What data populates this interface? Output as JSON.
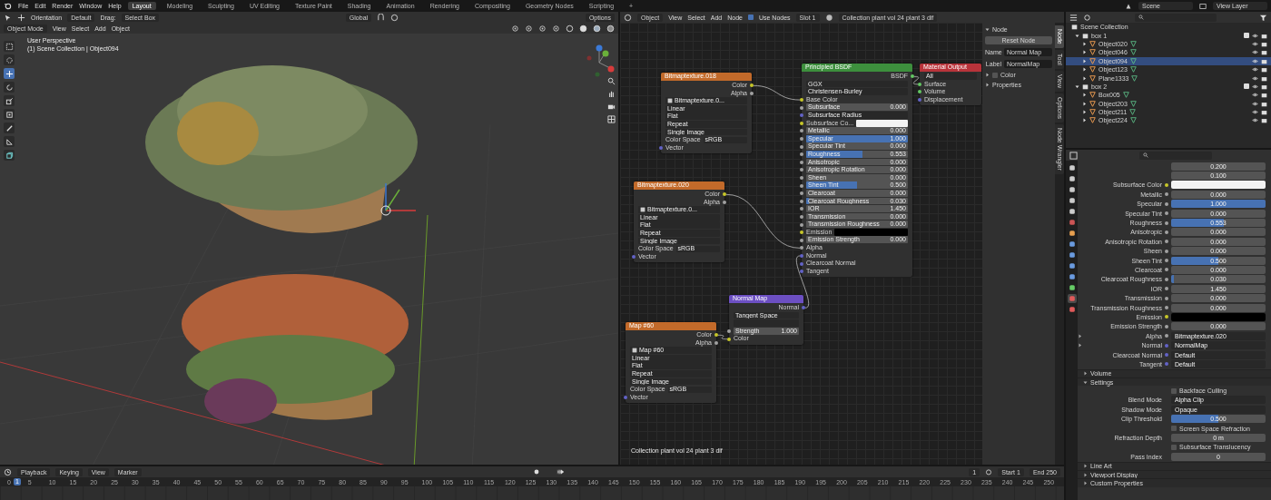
{
  "topbar": {
    "menus": [
      "File",
      "Edit",
      "Render",
      "Window",
      "Help"
    ],
    "workspaces": [
      {
        "label": "Layout",
        "selected": true
      },
      {
        "label": "Modeling",
        "selected": false
      },
      {
        "label": "Sculpting",
        "selected": false
      },
      {
        "label": "UV Editing",
        "selected": false
      },
      {
        "label": "Texture Paint",
        "selected": false
      },
      {
        "label": "Shading",
        "selected": false
      },
      {
        "label": "Animation",
        "selected": false
      },
      {
        "label": "Rendering",
        "selected": false
      },
      {
        "label": "Compositing",
        "selected": false
      },
      {
        "label": "Geometry Nodes",
        "selected": false
      },
      {
        "label": "Scripting",
        "selected": false
      }
    ],
    "add_tab": "+",
    "scene": "Scene",
    "view_layer": "View Layer"
  },
  "viewport": {
    "tool_header": {
      "orientation": "Orientation",
      "transform": "Default",
      "drag_label": "Drag:",
      "drag": "Select Box",
      "pivot": "Global",
      "options": "Options"
    },
    "header": {
      "mode": "Object Mode",
      "menus": [
        "View",
        "Select",
        "Add",
        "Object"
      ]
    },
    "overlay": {
      "title": "User Perspective",
      "subtitle": "(1) Scene Collection | Object094"
    },
    "tools": [
      {
        "kind": "select",
        "selected": false
      },
      {
        "kind": "cursor",
        "selected": false
      },
      {
        "kind": "move",
        "selected": true
      },
      {
        "kind": "rotate",
        "selected": false
      },
      {
        "kind": "scale",
        "selected": false
      },
      {
        "kind": "transform",
        "selected": false
      },
      {
        "kind": "annotate",
        "selected": false
      },
      {
        "kind": "measure",
        "selected": false
      },
      {
        "kind": "add",
        "selected": false
      }
    ]
  },
  "node_editor": {
    "header": {
      "type": "Object",
      "menus": [
        "View",
        "Select",
        "Add",
        "Node"
      ],
      "use_nodes": {
        "label": "Use Nodes",
        "checked": true
      },
      "slot": "Slot 1",
      "material": "Collection plant vol 24 plant 3 dif"
    },
    "nodes": [
      {
        "kind": "image_texture",
        "title": "Bitmaptexture.018",
        "color": "#c26a2a",
        "rows": [
          {
            "kind": "output",
            "label": "Color",
            "socket": {
              "color": "#c7c729"
            }
          },
          {
            "kind": "output",
            "label": "Alpha",
            "socket": {
              "color": "#a1a1a1"
            }
          },
          {
            "kind": "image",
            "value": "Bitmaptexture.0..."
          },
          {
            "kind": "dropdown",
            "value": "Linear"
          },
          {
            "kind": "dropdown",
            "value": "Flat"
          },
          {
            "kind": "dropdown",
            "value": "Repeat"
          },
          {
            "kind": "dropdown",
            "value": "Single Image"
          },
          {
            "kind": "prop",
            "label": "Color Space",
            "value": "sRGB"
          },
          {
            "kind": "input",
            "label": "Vector",
            "socket": {
              "color": "#6363c7"
            }
          }
        ]
      },
      {
        "kind": "image_texture",
        "title": "Bitmaptexture.020",
        "color": "#c26a2a",
        "rows": [
          {
            "kind": "output",
            "label": "Color",
            "socket": {
              "color": "#c7c729"
            }
          },
          {
            "kind": "output",
            "label": "Alpha",
            "socket": {
              "color": "#a1a1a1"
            }
          },
          {
            "kind": "image",
            "value": "Bitmaptexture.0..."
          },
          {
            "kind": "dropdown",
            "value": "Linear"
          },
          {
            "kind": "dropdown",
            "value": "Flat"
          },
          {
            "kind": "dropdown",
            "value": "Repeat"
          },
          {
            "kind": "dropdown",
            "value": "Single Image"
          },
          {
            "kind": "prop",
            "label": "Color Space",
            "value": "sRGB"
          },
          {
            "kind": "input",
            "label": "Vector",
            "socket": {
              "color": "#6363c7"
            }
          }
        ]
      },
      {
        "kind": "normal_map",
        "title": "Normal Map",
        "color": "#6c4fc2",
        "rows": [
          {
            "kind": "output",
            "label": "Normal",
            "socket": {
              "color": "#6363c7"
            }
          },
          {
            "kind": "dropdown",
            "value": "Tangent Space"
          },
          {
            "kind": "uv"
          },
          {
            "kind": "field",
            "label": "Strength",
            "value": "1.000",
            "socket": {
              "color": "#a1a1a1"
            }
          },
          {
            "kind": "input",
            "label": "Color",
            "socket": {
              "color": "#c7c729"
            }
          }
        ]
      },
      {
        "kind": "image_texture",
        "title": "Map #60",
        "color": "#c26a2a",
        "rows": [
          {
            "kind": "output",
            "label": "Color",
            "socket": {
              "color": "#c7c729"
            }
          },
          {
            "kind": "output",
            "label": "Alpha",
            "socket": {
              "color": "#a1a1a1"
            }
          },
          {
            "kind": "image",
            "value": "Map #60"
          },
          {
            "kind": "dropdown",
            "value": "Linear"
          },
          {
            "kind": "dropdown",
            "value": "Flat"
          },
          {
            "kind": "dropdown",
            "value": "Repeat"
          },
          {
            "kind": "dropdown",
            "value": "Single Image"
          },
          {
            "kind": "prop",
            "label": "Color Space",
            "value": "sRGB"
          },
          {
            "kind": "input",
            "label": "Vector",
            "socket": {
              "color": "#6363c7"
            }
          }
        ]
      },
      {
        "kind": "principled",
        "title": "Principled BSDF",
        "color": "#3d8f3d",
        "rows": [
          {
            "kind": "output",
            "label": "BSDF",
            "socket": {
              "color": "#63c763"
            }
          },
          {
            "kind": "dropdown",
            "value": "GGX"
          },
          {
            "kind": "dropdown",
            "value": "Christensen-Burley"
          },
          {
            "kind": "input",
            "label": "Base Color",
            "socket": {
              "color": "#c7c729"
            }
          },
          {
            "kind": "slider",
            "label": "Subsurface",
            "value": "0.000",
            "level": 0,
            "socket": {
              "color": "#a1a1a1"
            }
          },
          {
            "kind": "dropdown",
            "value": "Subsurface Radius",
            "socket": {
              "color": "#6363c7"
            }
          },
          {
            "kind": "swatch",
            "label": "Subsurface Co...",
            "color": "#f2f2f2",
            "socket": {
              "color": "#c7c729"
            }
          },
          {
            "kind": "slider",
            "label": "Metallic",
            "value": "0.000",
            "level": 0,
            "socket": {
              "color": "#a1a1a1"
            }
          },
          {
            "kind": "slider",
            "label": "Specular",
            "value": "1.000",
            "level": 1,
            "socket": {
              "color": "#a1a1a1"
            }
          },
          {
            "kind": "slider",
            "label": "Specular Tint",
            "value": "0.000",
            "level": 0,
            "socket": {
              "color": "#a1a1a1"
            }
          },
          {
            "kind": "slider",
            "label": "Roughness",
            "value": "0.553",
            "level": 0.553,
            "socket": {
              "color": "#a1a1a1"
            }
          },
          {
            "kind": "slider",
            "label": "Anisotropic",
            "value": "0.000",
            "level": 0,
            "socket": {
              "color": "#a1a1a1"
            }
          },
          {
            "kind": "slider",
            "label": "Anisotropic Rotation",
            "value": "0.000",
            "level": 0,
            "socket": {
              "color": "#a1a1a1"
            }
          },
          {
            "kind": "slider",
            "label": "Sheen",
            "value": "0.000",
            "level": 0,
            "socket": {
              "color": "#a1a1a1"
            }
          },
          {
            "kind": "slider",
            "label": "Sheen Tint",
            "value": "0.500",
            "level": 0.5,
            "socket": {
              "color": "#a1a1a1"
            }
          },
          {
            "kind": "slider",
            "label": "Clearcoat",
            "value": "0.000",
            "level": 0,
            "socket": {
              "color": "#a1a1a1"
            }
          },
          {
            "kind": "slider",
            "label": "Clearcoat Roughness",
            "value": "0.030",
            "level": 0.03,
            "socket": {
              "color": "#a1a1a1"
            }
          },
          {
            "kind": "slider",
            "label": "IOR",
            "value": "1.450",
            "level": 0,
            "socket": {
              "color": "#a1a1a1"
            }
          },
          {
            "kind": "slider",
            "label": "Transmission",
            "value": "0.000",
            "level": 0,
            "socket": {
              "color": "#a1a1a1"
            }
          },
          {
            "kind": "slider",
            "label": "Transmission Roughness",
            "value": "0.000",
            "level": 0,
            "socket": {
              "color": "#a1a1a1"
            }
          },
          {
            "kind": "swatch",
            "label": "Emission",
            "color": "#000000",
            "socket": {
              "color": "#c7c729"
            }
          },
          {
            "kind": "slider",
            "label": "Emission Strength",
            "value": "0.000",
            "level": 0,
            "socket": {
              "color": "#a1a1a1"
            }
          },
          {
            "kind": "input",
            "label": "Alpha",
            "socket": {
              "color": "#a1a1a1"
            }
          },
          {
            "kind": "input",
            "label": "Normal",
            "socket": {
              "color": "#6363c7"
            }
          },
          {
            "kind": "input",
            "label": "Clearcoat Normal",
            "socket": {
              "color": "#6363c7"
            }
          },
          {
            "kind": "input",
            "label": "Tangent",
            "socket": {
              "color": "#6363c7"
            }
          }
        ]
      },
      {
        "kind": "output",
        "title": "Material Output",
        "color": "#b8333a",
        "rows": [
          {
            "kind": "dropdown",
            "value": "All"
          },
          {
            "kind": "input",
            "label": "Surface",
            "socket": {
              "color": "#63c763"
            }
          },
          {
            "kind": "input",
            "label": "Volume",
            "socket": {
              "color": "#63c763"
            }
          },
          {
            "kind": "input",
            "label": "Displacement",
            "socket": {
              "color": "#6363c7"
            }
          }
        ]
      }
    ],
    "footer": "Collection plant vol 24 plant 3 dif",
    "sidebar": {
      "panel": "Node",
      "reset": "Reset Node",
      "fields": [
        {
          "label": "Name",
          "value": "Normal Map"
        },
        {
          "label": "Label",
          "value": "NormalMap"
        }
      ],
      "color_panel": {
        "label": "Color",
        "expanded": false,
        "checked": false
      },
      "properties_panel": {
        "label": "Properties",
        "expanded": false
      }
    },
    "sidebar_tabs": [
      {
        "label": "Node",
        "selected": true
      },
      {
        "label": "Tool",
        "selected": false
      },
      {
        "label": "View",
        "selected": false
      },
      {
        "label": "Options",
        "selected": false
      },
      {
        "label": "Node Wrangler",
        "selected": false
      }
    ]
  },
  "outliner": {
    "root": "Scene Collection",
    "items": [
      {
        "label": "box 1",
        "expanded": true,
        "checked": true,
        "children": [
          {
            "label": "Object020",
            "selected": false
          },
          {
            "label": "Object046",
            "selected": false
          },
          {
            "label": "Object094",
            "selected": true
          },
          {
            "label": "Object123",
            "selected": false
          },
          {
            "label": "Plane1333",
            "selected": false
          }
        ]
      },
      {
        "label": "box 2",
        "expanded": true,
        "checked": true,
        "children": [
          {
            "label": "Box005",
            "selected": false
          },
          {
            "label": "Object203",
            "selected": false
          },
          {
            "label": "Object211",
            "selected": false
          },
          {
            "label": "Object224",
            "selected": false
          }
        ]
      }
    ]
  },
  "properties": {
    "tabs": [
      {
        "kind": "tool",
        "selected": false
      },
      {
        "kind": "render",
        "selected": false
      },
      {
        "kind": "output",
        "selected": false
      },
      {
        "kind": "view_layer",
        "selected": false
      },
      {
        "kind": "scene",
        "selected": false
      },
      {
        "kind": "world",
        "selected": false
      },
      {
        "kind": "object",
        "selected": false
      },
      {
        "kind": "modifiers",
        "selected": false
      },
      {
        "kind": "particles",
        "selected": false
      },
      {
        "kind": "physics",
        "selected": false
      },
      {
        "kind": "constraints",
        "selected": false
      },
      {
        "kind": "data",
        "selected": false
      },
      {
        "kind": "material",
        "selected": true
      },
      {
        "kind": "texture",
        "selected": false
      }
    ],
    "rows": [
      {
        "kind": "value",
        "value": "0.200"
      },
      {
        "kind": "value",
        "value": "0.100"
      },
      {
        "kind": "swatch",
        "label": "Subsurface Color",
        "color": "#f2f2f2",
        "socket": {
          "color": "#c7c729"
        }
      },
      {
        "kind": "slider",
        "label": "Metallic",
        "value": "0.000",
        "level": 0,
        "socket": {
          "color": "#a1a1a1"
        }
      },
      {
        "kind": "slider",
        "label": "Specular",
        "value": "1.000",
        "level": 1,
        "socket": {
          "color": "#a1a1a1"
        }
      },
      {
        "kind": "slider",
        "label": "Specular Tint",
        "value": "0.000",
        "level": 0,
        "socket": {
          "color": "#a1a1a1"
        }
      },
      {
        "kind": "slider",
        "label": "Roughness",
        "value": "0.553",
        "level": 0.553,
        "socket": {
          "color": "#a1a1a1"
        }
      },
      {
        "kind": "slider",
        "label": "Anisotropic",
        "value": "0.000",
        "level": 0,
        "socket": {
          "color": "#a1a1a1"
        }
      },
      {
        "kind": "slider",
        "label": "Anisotropic Rotation",
        "value": "0.000",
        "level": 0,
        "socket": {
          "color": "#a1a1a1"
        }
      },
      {
        "kind": "slider",
        "label": "Sheen",
        "value": "0.000",
        "level": 0,
        "socket": {
          "color": "#a1a1a1"
        }
      },
      {
        "kind": "slider",
        "label": "Sheen Tint",
        "value": "0.500",
        "level": 0.5,
        "socket": {
          "color": "#a1a1a1"
        }
      },
      {
        "kind": "slider",
        "label": "Clearcoat",
        "value": "0.000",
        "level": 0,
        "socket": {
          "color": "#a1a1a1"
        }
      },
      {
        "kind": "slider",
        "label": "Clearcoat Roughness",
        "value": "0.030",
        "level": 0.03,
        "socket": {
          "color": "#a1a1a1"
        }
      },
      {
        "kind": "slider",
        "label": "IOR",
        "value": "1.450",
        "level": 0,
        "socket": {
          "color": "#a1a1a1"
        }
      },
      {
        "kind": "slider",
        "label": "Transmission",
        "value": "0.000",
        "level": 0,
        "socket": {
          "color": "#a1a1a1"
        }
      },
      {
        "kind": "slider",
        "label": "Transmission Roughness",
        "value": "0.000",
        "level": 0,
        "socket": {
          "color": "#a1a1a1"
        }
      },
      {
        "kind": "swatch",
        "label": "Emission",
        "color": "#000000",
        "socket": {
          "color": "#c7c729"
        }
      },
      {
        "kind": "slider",
        "label": "Emission Strength",
        "value": "0.000",
        "level": 0,
        "socket": {
          "color": "#a1a1a1"
        }
      },
      {
        "kind": "link",
        "label": "Alpha",
        "value": "Bitmaptexture.020",
        "socket": {
          "color": "#a1a1a1"
        },
        "expandable": true
      },
      {
        "kind": "link",
        "label": "Normal",
        "value": "NormalMap",
        "socket": {
          "color": "#6363c7"
        },
        "expandable": true
      },
      {
        "kind": "link",
        "label": "Clearcoat Normal",
        "value": "Default",
        "socket": {
          "color": "#6363c7"
        },
        "expandable": false
      },
      {
        "kind": "link",
        "label": "Tangent",
        "value": "Default",
        "socket": {
          "color": "#6363c7"
        },
        "expandable": false
      }
    ],
    "sections": [
      {
        "label": "Volume",
        "expanded": false
      },
      {
        "label": "Settings",
        "expanded": true,
        "rows": [
          {
            "kind": "checkbox",
            "label": "Backface Culling",
            "checked": false
          },
          {
            "kind": "dropdown",
            "label": "Blend Mode",
            "value": "Alpha Clip"
          },
          {
            "kind": "dropdown",
            "label": "Shadow Mode",
            "value": "Opaque"
          },
          {
            "kind": "slider",
            "label": "Clip Threshold",
            "value": "0.500",
            "level": 0.5
          },
          {
            "kind": "checkbox",
            "label": "Screen Space Refraction",
            "checked": false
          },
          {
            "kind": "field",
            "label": "Refraction Depth",
            "value": "0 m"
          },
          {
            "kind": "checkbox",
            "label": "Subsurface Translucency",
            "checked": false
          },
          {
            "kind": "field",
            "label": "Pass Index",
            "value": "0"
          }
        ]
      },
      {
        "label": "Line Art",
        "expanded": false
      },
      {
        "label": "Viewport Display",
        "expanded": false
      },
      {
        "label": "Custom Properties",
        "expanded": false
      }
    ]
  },
  "timeline": {
    "menus": [
      "Playback",
      "Keying",
      "View",
      "Marker"
    ],
    "current_frame": "1",
    "start_label": "Start",
    "start": "1",
    "end_label": "End",
    "end": "250",
    "playhead": "1",
    "ruler": [
      "0",
      "5",
      "10",
      "15",
      "20",
      "25",
      "30",
      "35",
      "40",
      "45",
      "50",
      "55",
      "60",
      "65",
      "70",
      "75",
      "80",
      "85",
      "90",
      "95",
      "100",
      "105",
      "110",
      "115",
      "120",
      "125",
      "130",
      "135",
      "140",
      "145",
      "150",
      "155",
      "160",
      "165",
      "170",
      "175",
      "180",
      "185",
      "190",
      "195",
      "200",
      "205",
      "210",
      "215",
      "220",
      "225",
      "230",
      "235",
      "240",
      "245",
      "250"
    ]
  }
}
